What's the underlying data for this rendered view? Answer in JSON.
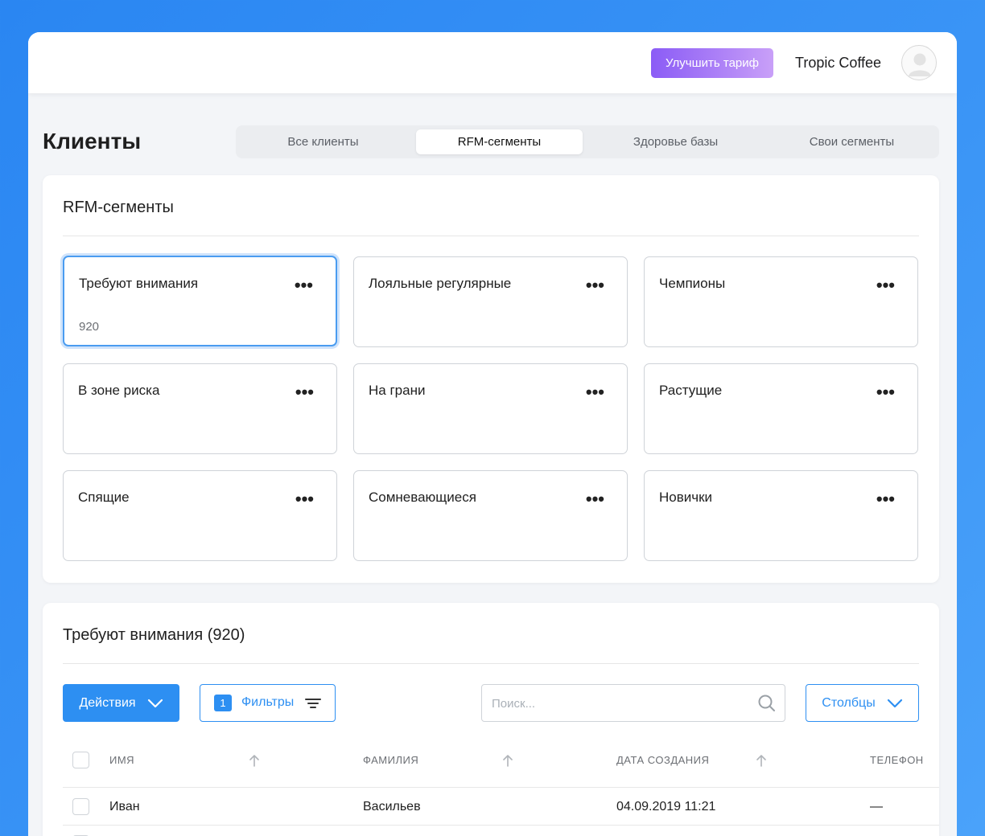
{
  "topbar": {
    "upgrade_label": "Улучшить тариф",
    "company_name": "Tropic Coffee"
  },
  "page": {
    "title": "Клиенты",
    "tabs": [
      {
        "label": "Все клиенты",
        "active": false
      },
      {
        "label": "RFM-сегменты",
        "active": true
      },
      {
        "label": "Здоровье базы",
        "active": false
      },
      {
        "label": "Свои сегменты",
        "active": false
      }
    ]
  },
  "segments_panel": {
    "title": "RFM-сегменты",
    "cards": [
      {
        "name": "Требуют внимания",
        "count": "920",
        "selected": true
      },
      {
        "name": "Лояльные регулярные",
        "count": "",
        "selected": false
      },
      {
        "name": "Чемпионы",
        "count": "",
        "selected": false
      },
      {
        "name": "В зоне риска",
        "count": "",
        "selected": false
      },
      {
        "name": "На грани",
        "count": "",
        "selected": false
      },
      {
        "name": "Растущие",
        "count": "",
        "selected": false
      },
      {
        "name": "Спящие",
        "count": "",
        "selected": false
      },
      {
        "name": "Сомневающиеся",
        "count": "",
        "selected": false
      },
      {
        "name": "Новички",
        "count": "",
        "selected": false
      }
    ],
    "more_glyph": "•••"
  },
  "clients_panel": {
    "title": "Требуют внимания (920)",
    "actions_label": "Действия",
    "filters_label": "Фильтры",
    "filters_count": "1",
    "search_placeholder": "Поиск...",
    "columns_label": "Столбцы",
    "columns": [
      "ИМЯ",
      "ФАМИЛИЯ",
      "ДАТА СОЗДАНИЯ",
      "ТЕЛЕФОН"
    ],
    "rows": [
      {
        "first_name": "Иван",
        "last_name": "Васильев",
        "created": "04.09.2019 11:21",
        "phone": "—"
      }
    ]
  },
  "colors": {
    "accent": "#2d8ff2",
    "upgrade_gradient_start": "#8b5cf6",
    "upgrade_gradient_end": "#c9a0f8",
    "background": "#3b95f6"
  }
}
